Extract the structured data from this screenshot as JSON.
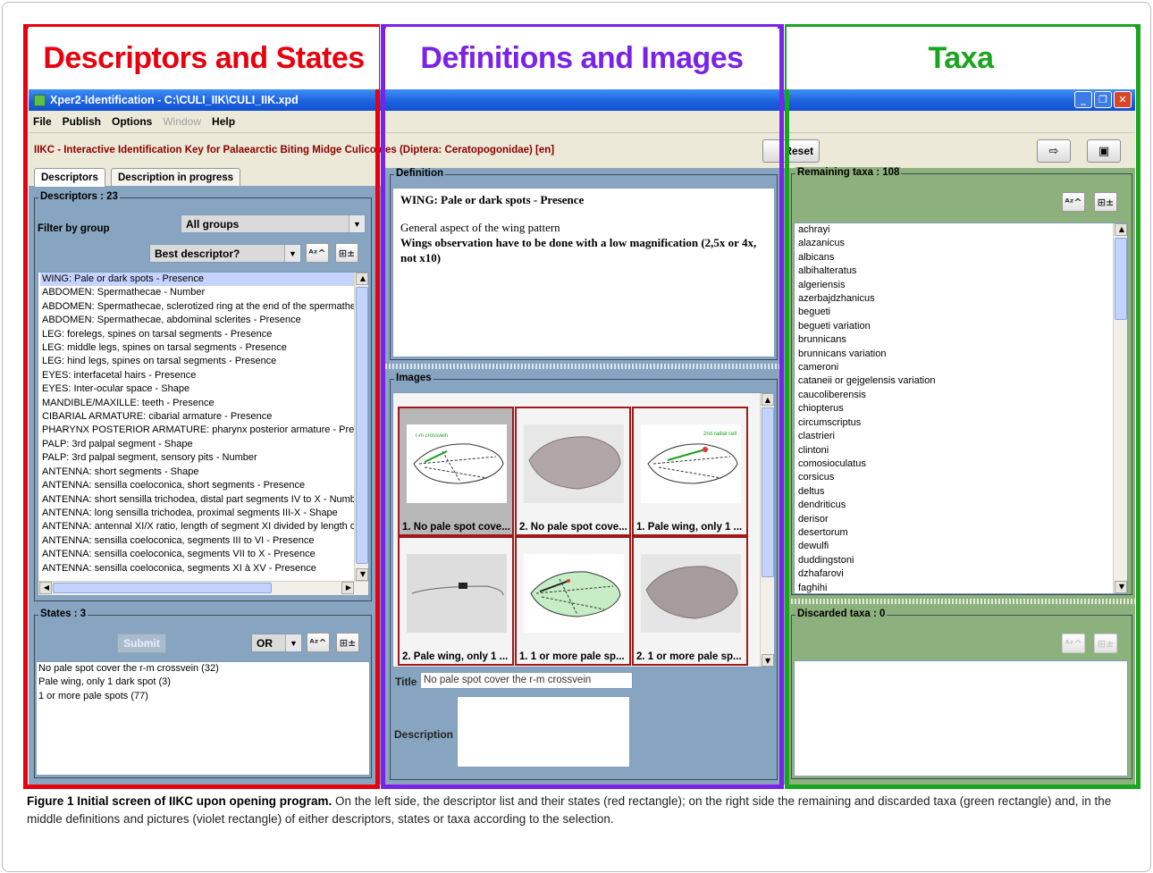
{
  "headings": {
    "left": "Descriptors and States",
    "middle": "Definitions and Images",
    "right": "Taxa"
  },
  "colors": {
    "left": "#e8000e",
    "middle": "#7a22e8",
    "right": "#19a51f"
  },
  "window": {
    "title": "Xper2-Identification  -  C:\\CULI_IIK\\CULI_IIK.xpd",
    "icons": [
      "minimize-icon",
      "restore-icon",
      "close-icon"
    ]
  },
  "menu": [
    "File",
    "Publish",
    "Options",
    "Window",
    "Help"
  ],
  "key_title": "IIKC - Interactive Identification Key for Palaearctic Biting Midge Culicoides (Diptera: Ceratopogonidae) [en]",
  "reset_label": "Reset",
  "tabs": [
    "Descriptors",
    "Description in progress"
  ],
  "descriptors": {
    "title": "Descriptors : 23",
    "filter_label": "Filter by group",
    "group_value": "All groups",
    "sort_value": "Best descriptor?",
    "items": [
      "WING: Pale or dark spots - Presence",
      "ABDOMEN: Spermathecae - Number",
      "ABDOMEN: Spermathecae, sclerotized ring at the end of the spermathecae duct - Presence",
      "ABDOMEN: Spermathecae, abdominal sclerites - Presence",
      "LEG: forelegs, spines on tarsal segments - Presence",
      "LEG: middle legs, spines on tarsal segments - Presence",
      "LEG: hind legs, spines on tarsal segments - Presence",
      "EYES: interfacetal hairs - Presence",
      "EYES: Inter-ocular space - Shape",
      "MANDIBLE/MAXILLE: teeth - Presence",
      "CIBARIAL ARMATURE: cibarial armature - Presence",
      "PHARYNX POSTERIOR ARMATURE: pharynx posterior armature - Presence",
      "PALP: 3rd palpal segment - Shape",
      "PALP: 3rd palpal segment, sensory pits - Number",
      "ANTENNA: short segments - Shape",
      "ANTENNA: sensilla coeloconica, short segments - Presence",
      "ANTENNA: short sensilla trichodea, distal part segments IV to X - Number",
      "ANTENNA: long sensilla trichodea, proximal segments III-X - Shape",
      "ANTENNA: antennal XI/X ratio, length of segment XI divided by length of segment X",
      "ANTENNA: sensilla coeloconica, segments III to VI - Presence",
      "ANTENNA: sensilla coeloconica, segments VII to X - Presence",
      "ANTENNA: sensilla coeloconica, segments XI à XV - Presence"
    ]
  },
  "states": {
    "title": "States : 3",
    "submit": "Submit",
    "operator": "OR",
    "items": [
      "No pale spot cover the r-m crossvein (32)",
      "Pale wing, only 1 dark spot (3)",
      "1 or more pale spots (77)"
    ]
  },
  "definition": {
    "title": "Definition",
    "heading": "WING: Pale or dark spots - Presence",
    "line1": "General aspect of the wing pattern",
    "line2": "Wings observation have to be done with a low magnification (2,5x or 4x, not x10)"
  },
  "images": {
    "title": "Images",
    "captions": [
      "1. No pale spot cove...",
      "2. No pale spot cove...",
      "1. Pale wing, only 1 ...",
      "2. Pale wing, only 1 ...",
      "1. 1 or more pale sp...",
      "2. 1 or more pale sp..."
    ],
    "title_label": "Title",
    "title_value": "No pale spot cover the r-m crossvein",
    "description_label": "Description"
  },
  "remaining": {
    "title": "Remaining taxa : 108",
    "items": [
      "achrayi",
      "alazanicus",
      "albicans",
      "albihalteratus",
      "algeriensis",
      "azerbajdzhanicus",
      "begueti",
      "begueti variation",
      "brunnicans",
      "brunnicans variation",
      "cameroni",
      "cataneii or gejgelensis variation",
      "caucoliberensis",
      "chiopterus",
      "circumscriptus",
      "clastrieri",
      "clintoni",
      "comosioculatus",
      "corsicus",
      "deltus",
      "dendriticus",
      "derisor",
      "desertorum",
      "dewulfi",
      "duddingstoni",
      "dzhafarovi",
      "faghihi"
    ]
  },
  "discarded": {
    "title": "Discarded taxa : 0"
  },
  "caption": {
    "bold": "Figure 1 Initial screen of IIKC upon opening program.",
    "text": " On the left side, the descriptor list and their states (red rectangle); on the right side the remaining and discarded taxa (green rectangle) and, in the middle definitions and pictures (violet rectangle) of either descriptors, states or taxa according to the selection."
  }
}
